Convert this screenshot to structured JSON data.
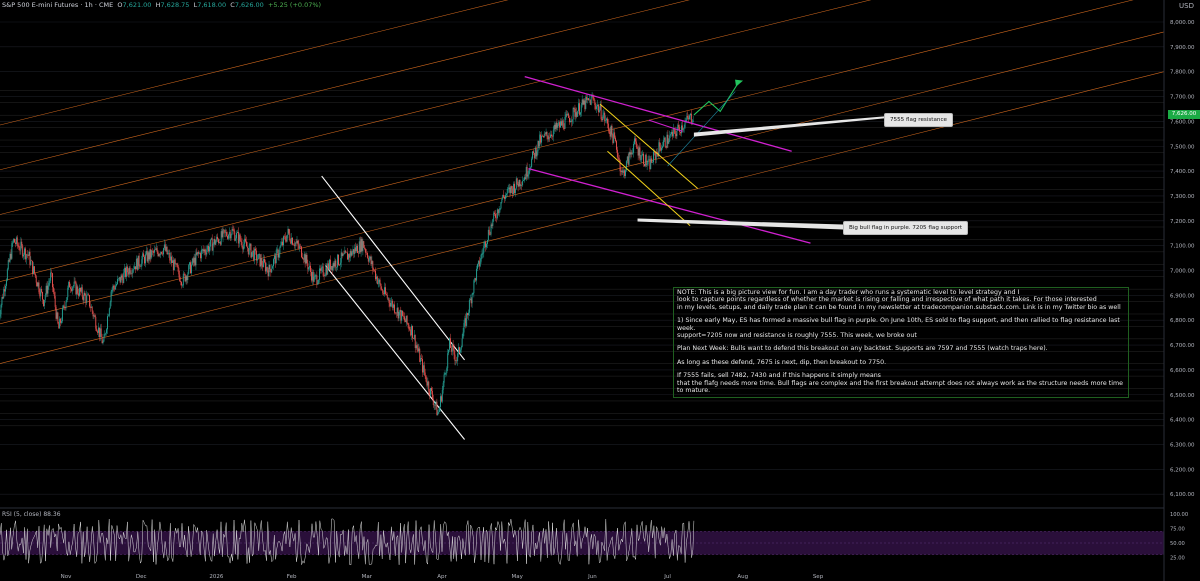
{
  "header": {
    "symbol": "S&P 500 E-mini Futures · 1h · CME",
    "open_label": "O",
    "open": "7,621.00",
    "high_label": "H",
    "high": "7,628.75",
    "low_label": "L",
    "low": "7,618.00",
    "close_label": "C",
    "close": "7,626.00",
    "change": "+5.25 (+0.07%)"
  },
  "axis_currency": "USD",
  "last_price_tag": "7,626.00",
  "rsi_label": "RSI (5, close) 88.36",
  "callouts": {
    "resistance": "7555 flag resistance",
    "support": "Big bull flag in purple. 7205 flag support"
  },
  "note": {
    "p1": "NOTE: This is a big picture view for fun. I am a day trader who runs a systematic level to level strategy and I\nlook to capture points regardless of whether the market is rising or falling and irrespective of what path it takes. For those interested\nin my levels, setups, and daily trade plan it can be found in my newsletter at tradecompanion.substack.com. Link is in my Twitter bio as well",
    "p2": "1) Since early May, ES has formed a massive bull flag in purple. On June 10th, ES sold to flag support, and then rallied to flag resistance last week.\nsupport=7205 now and resistance is roughly 7555. This week, we broke out",
    "p3": "Plan Next Week: Bulls want to defend this breakout on any backtest. Supports are 7597 and 7555 (watch traps here).",
    "p4": "As long as these defend, 7675 is next, dip, then breakout to 7750.",
    "p5": "If 7555 fails, sell 7482, 7430 and if this happens it simply means\nthat the flafg needs more time. Bull flags are complex and the first breakout attempt does not always work as the structure needs more time\nto mature."
  },
  "colors": {
    "up": "#26a69a",
    "down": "#ef5350",
    "channel": "#d2691e",
    "flag": "#d020d0",
    "trend": "#ffffff",
    "yellow": "#f2d21b",
    "green_path": "#22c55e",
    "rsi": "#e0e0e0",
    "rsi_band": "#2a0f3a"
  },
  "chart_data": {
    "type": "candlestick",
    "price_axis": {
      "ticks": [
        "8,000.00",
        "7,900.00",
        "7,800.00",
        "7,700.00",
        "7,600.00",
        "7,500.00",
        "7,400.00",
        "7,300.00",
        "7,200.00",
        "7,100.00",
        "7,000.00",
        "6,900.00",
        "6,800.00",
        "6,700.00",
        "6,600.00",
        "6,500.00",
        "6,400.00",
        "6,300.00",
        "6,200.00",
        "6,100.00"
      ],
      "ylim": [
        6050,
        8050
      ]
    },
    "time_axis": {
      "labels": [
        "Nov",
        "Dec",
        "2026",
        "Feb",
        "Mar",
        "Apr",
        "May",
        "Jun",
        "Jul",
        "Aug",
        "Sep"
      ],
      "positions": [
        0.0,
        1.0,
        2.0,
        3.0,
        4.0,
        5.0,
        6.0,
        7.0,
        8.0,
        9.0,
        10.0
      ]
    },
    "price_path": [
      [
        -0.9,
        6810
      ],
      [
        -0.7,
        7120
      ],
      [
        -0.5,
        7060
      ],
      [
        -0.3,
        6880
      ],
      [
        -0.2,
        6980
      ],
      [
        -0.1,
        6760
      ],
      [
        0.05,
        6950
      ],
      [
        0.3,
        6880
      ],
      [
        0.5,
        6700
      ],
      [
        0.6,
        6920
      ],
      [
        0.85,
        7010
      ],
      [
        1.05,
        7050
      ],
      [
        1.3,
        7090
      ],
      [
        1.55,
        6960
      ],
      [
        1.75,
        7060
      ],
      [
        2.0,
        7120
      ],
      [
        2.2,
        7160
      ],
      [
        2.45,
        7080
      ],
      [
        2.7,
        7000
      ],
      [
        2.95,
        7150
      ],
      [
        3.15,
        7070
      ],
      [
        3.3,
        6960
      ],
      [
        3.5,
        7020
      ],
      [
        3.75,
        7060
      ],
      [
        3.95,
        7110
      ],
      [
        4.2,
        6920
      ],
      [
        4.35,
        6860
      ],
      [
        4.6,
        6760
      ],
      [
        4.75,
        6600
      ],
      [
        4.95,
        6420
      ],
      [
        5.1,
        6700
      ],
      [
        5.2,
        6640
      ],
      [
        5.45,
        6980
      ],
      [
        5.6,
        7140
      ],
      [
        5.8,
        7290
      ],
      [
        6.1,
        7380
      ],
      [
        6.3,
        7520
      ],
      [
        6.6,
        7590
      ],
      [
        6.85,
        7660
      ],
      [
        7.0,
        7690
      ],
      [
        7.15,
        7620
      ],
      [
        7.3,
        7520
      ],
      [
        7.4,
        7380
      ],
      [
        7.55,
        7510
      ],
      [
        7.75,
        7420
      ],
      [
        7.9,
        7500
      ],
      [
        8.05,
        7540
      ],
      [
        8.25,
        7600
      ],
      [
        8.35,
        7626
      ]
    ],
    "last_close": 7626.0,
    "annotation_levels": [
      7555,
      7205
    ],
    "projected_path": [
      [
        8.35,
        7626
      ],
      [
        8.55,
        7680
      ],
      [
        8.7,
        7640
      ],
      [
        8.95,
        7760
      ]
    ],
    "rsi": {
      "period": 5,
      "value": 88.36,
      "ticks": [
        "100.00",
        "75.00",
        "50.00",
        "25.00"
      ],
      "band": [
        30,
        70
      ]
    }
  }
}
